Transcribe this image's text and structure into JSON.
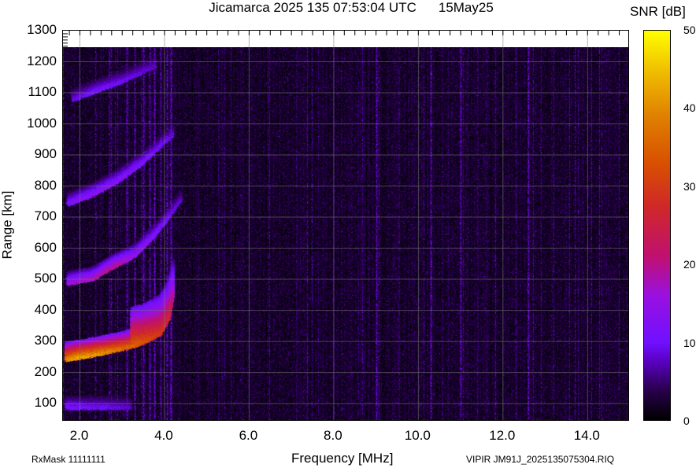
{
  "header": {
    "title": "Jicamarca 2025 135 07:53:04 UTC",
    "date": "15May25"
  },
  "footer": {
    "rxmask": "RxMask 11111111",
    "file": "VIPIR  JM91J_2025135075304.RIQ"
  },
  "chart_data": {
    "type": "heatmap",
    "title": "Jicamarca 2025 135 07:53:04 UTC   15May25",
    "xlabel": "Frequency [MHz]",
    "ylabel": "Range [km]",
    "xlim": [
      1.6,
      15.0
    ],
    "ylim": [
      42,
      1300
    ],
    "data_top_km": 1245,
    "xticks": [
      "2.0",
      "4.0",
      "6.0",
      "8.0",
      "10.0",
      "12.0",
      "14.0"
    ],
    "xtick_values": [
      2,
      4,
      6,
      8,
      10,
      12,
      14
    ],
    "yticks": [
      "100",
      "200",
      "300",
      "400",
      "500",
      "600",
      "700",
      "800",
      "900",
      "1000",
      "1100",
      "1200",
      "1300"
    ],
    "ytick_values": [
      100,
      200,
      300,
      400,
      500,
      600,
      700,
      800,
      900,
      1000,
      1100,
      1200,
      1300
    ],
    "grid": true,
    "colorbar": {
      "label": "SNR [dB]",
      "ticks": [
        "0",
        "10",
        "20",
        "30",
        "40",
        "50"
      ],
      "tick_values": [
        0,
        10,
        20,
        30,
        40,
        50
      ],
      "range": [
        0,
        50
      ]
    },
    "traces": [
      {
        "name": "F-layer 1-hop",
        "points": [
          [
            1.65,
            245,
            38
          ],
          [
            2.0,
            252,
            42
          ],
          [
            2.5,
            265,
            40
          ],
          [
            3.0,
            280,
            36
          ],
          [
            3.5,
            300,
            32
          ],
          [
            3.9,
            330,
            28
          ],
          [
            4.1,
            380,
            25
          ],
          [
            4.2,
            450,
            18
          ]
        ]
      },
      {
        "name": "F-layer 2-hop",
        "points": [
          [
            1.7,
            490,
            16
          ],
          [
            2.3,
            505,
            18
          ],
          [
            2.8,
            545,
            20
          ],
          [
            3.3,
            580,
            15
          ],
          [
            3.8,
            650,
            12
          ],
          [
            4.4,
            760,
            8
          ]
        ]
      },
      {
        "name": "F-layer 3-hop",
        "points": [
          [
            1.7,
            745,
            12
          ],
          [
            2.3,
            775,
            14
          ],
          [
            2.9,
            820,
            13
          ],
          [
            3.5,
            880,
            12
          ],
          [
            4.2,
            970,
            9
          ]
        ]
      },
      {
        "name": "F-layer 4-hop",
        "points": [
          [
            1.8,
            1080,
            9
          ],
          [
            2.4,
            1110,
            11
          ],
          [
            3.0,
            1140,
            10
          ],
          [
            3.8,
            1190,
            8
          ]
        ]
      },
      {
        "name": "Es/E-layer",
        "points": [
          [
            1.65,
            90,
            12
          ],
          [
            2.5,
            90,
            10
          ],
          [
            3.2,
            90,
            8
          ]
        ]
      }
    ],
    "interference_MHz": [
      3.1,
      3.3,
      3.5,
      3.65,
      3.75,
      3.9,
      4.05,
      4.15,
      9.0,
      11.0,
      10.3,
      12.6
    ]
  }
}
